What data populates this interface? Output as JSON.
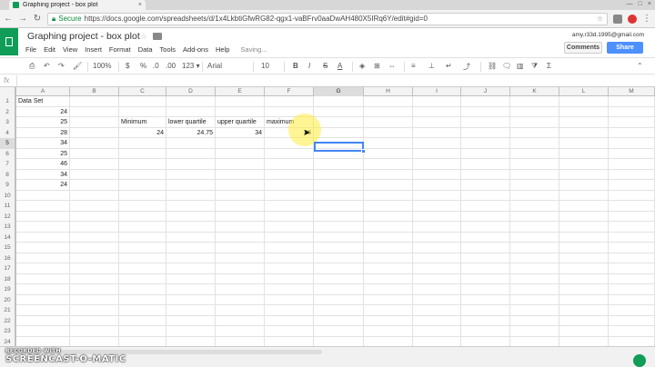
{
  "browser": {
    "tab_title": "Graphing project - box plot",
    "tab_close": "×",
    "secure_label": "Secure",
    "url": "https://docs.google.com/spreadsheets/d/1x4LkbtiGfwRG82-qgx1-vaBFrv0aaDwAH480X5IRq6Y/edit#gid=0",
    "window_controls": [
      "—",
      "□",
      "×"
    ]
  },
  "doc": {
    "title": "Graphing project - box plot",
    "user_email": "amy.r33d.1995@gmail.com",
    "comments_label": "Comments",
    "share_label": "Share",
    "menus": [
      "File",
      "Edit",
      "View",
      "Insert",
      "Format",
      "Data",
      "Tools",
      "Add-ons",
      "Help"
    ],
    "saving_status": "Saving..."
  },
  "toolbar": {
    "zoom": "100%",
    "currency": "$",
    "percent": "%",
    "decimal_less": ".0",
    "decimal_more": ".00",
    "more_formats": "123 ▾",
    "font": "Arial",
    "font_size": "10",
    "bold": "B",
    "italic": "I",
    "strike": "S",
    "text_color": "A"
  },
  "formula_bar": {
    "fx_label": "fx",
    "value": ""
  },
  "grid": {
    "columns": [
      "A",
      "B",
      "C",
      "D",
      "E",
      "F",
      "G",
      "H",
      "I",
      "J",
      "K",
      "L",
      "M"
    ],
    "selected_column": "G",
    "selected_row": "5",
    "rows": [
      {
        "n": "1",
        "cells": {
          "A": "Data Set"
        }
      },
      {
        "n": "2",
        "cells": {
          "A": "24"
        }
      },
      {
        "n": "3",
        "cells": {
          "A": "25",
          "C": "Minimum",
          "D": "lower quartile",
          "E": "upper quartile",
          "F": "maximum"
        }
      },
      {
        "n": "4",
        "cells": {
          "A": "28",
          "C": "24",
          "D": "24.75",
          "E": "34",
          "F": "46"
        }
      },
      {
        "n": "5",
        "cells": {
          "A": "34"
        }
      },
      {
        "n": "6",
        "cells": {
          "A": "25"
        }
      },
      {
        "n": "7",
        "cells": {
          "A": "46"
        }
      },
      {
        "n": "8",
        "cells": {
          "A": "34"
        }
      },
      {
        "n": "9",
        "cells": {
          "A": "24"
        }
      },
      {
        "n": "10",
        "cells": {}
      },
      {
        "n": "11",
        "cells": {}
      },
      {
        "n": "12",
        "cells": {}
      },
      {
        "n": "13",
        "cells": {}
      },
      {
        "n": "14",
        "cells": {}
      },
      {
        "n": "15",
        "cells": {}
      },
      {
        "n": "16",
        "cells": {}
      },
      {
        "n": "17",
        "cells": {}
      },
      {
        "n": "18",
        "cells": {}
      },
      {
        "n": "19",
        "cells": {}
      },
      {
        "n": "20",
        "cells": {}
      },
      {
        "n": "21",
        "cells": {}
      },
      {
        "n": "22",
        "cells": {}
      },
      {
        "n": "23",
        "cells": {}
      },
      {
        "n": "24",
        "cells": {}
      }
    ]
  },
  "watermark": {
    "line1": "RECORDED WITH",
    "line2": "SCREENCAST-O-MATIC"
  }
}
